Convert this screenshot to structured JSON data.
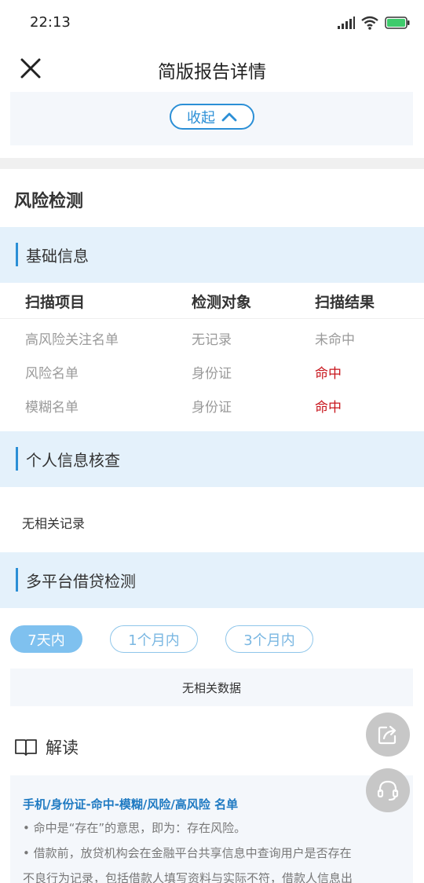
{
  "status_bar": {
    "time": "22:13"
  },
  "nav": {
    "title": "简版报告详情"
  },
  "collapse": {
    "label": "收起"
  },
  "risk_section": {
    "title": "风险检测"
  },
  "basic_info": {
    "header": "基础信息",
    "columns": [
      "扫描项目",
      "检测对象",
      "扫描结果"
    ],
    "rows": [
      {
        "item": "高风险关注名单",
        "target": "无记录",
        "result": "未命中"
      },
      {
        "item": "风险名单",
        "target": "身份证",
        "result": "命中"
      },
      {
        "item": "模糊名单",
        "target": "身份证",
        "result": "命中"
      }
    ]
  },
  "personal_check": {
    "header": "个人信息核查",
    "content": "无相关记录"
  },
  "multi_platform": {
    "header": "多平台借贷检测",
    "tabs": [
      {
        "label": "7天内",
        "active": true
      },
      {
        "label": "1个月内",
        "active": false
      },
      {
        "label": "3个月内",
        "active": false
      }
    ],
    "empty_text": "无相关数据"
  },
  "interpretation": {
    "title": "解读",
    "heading": "手机/身份证-命中-模糊/风险/高风险 名单",
    "lines": [
      "• 命中是“存在”的意思，即为：存在风险。",
      "• 借款前，放贷机构会在金融平台共享信息中查询用户是否存在",
      "不良行为记录，包括借款人填写资料与实际不符，借款人信息出"
    ]
  },
  "colors": {
    "accent": "#2b8fd6",
    "hit": "#c8161d",
    "section_bg": "#e4f1fb",
    "active_tab": "#7fc1ef"
  }
}
